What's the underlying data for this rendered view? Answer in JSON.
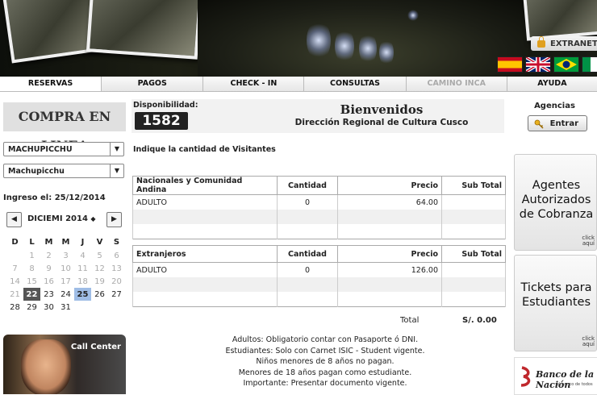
{
  "banner": {
    "extranet_label": "EXTRANET",
    "flags": [
      "spain-flag",
      "uk-flag",
      "brazil-flag",
      "italy-flag"
    ]
  },
  "nav": {
    "tabs": [
      {
        "label": "RESERVAS",
        "state": "active"
      },
      {
        "label": "PAGOS",
        "state": "normal"
      },
      {
        "label": "CHECK - IN",
        "state": "normal"
      },
      {
        "label": "CONSULTAS",
        "state": "normal"
      },
      {
        "label": "CAMINO INCA",
        "state": "disabled"
      },
      {
        "label": "AYUDA",
        "state": "normal"
      }
    ]
  },
  "left": {
    "compra_title": "COMPRA EN LINEA",
    "select_destination": "MACHUPICCHU",
    "select_route": "Machupicchu",
    "ingreso_label": "Ingreso el:",
    "ingreso_date": "25/12/2014",
    "calendar": {
      "month": "DICIEMI",
      "year": "2014",
      "weekdays": [
        "D",
        "L",
        "M",
        "M",
        "J",
        "V",
        "S"
      ],
      "weeks": [
        [
          "",
          "1",
          "2",
          "3",
          "4",
          "5",
          "6"
        ],
        [
          "7",
          "8",
          "9",
          "10",
          "11",
          "12",
          "13"
        ],
        [
          "14",
          "15",
          "16",
          "17",
          "18",
          "19",
          "20"
        ],
        [
          "21",
          "22",
          "23",
          "24",
          "25",
          "26",
          "27"
        ],
        [
          "28",
          "29",
          "30",
          "31",
          "",
          "",
          ""
        ]
      ],
      "selected_day": "22",
      "highlighted_day": "25"
    },
    "callcenter_label": "Call Center"
  },
  "main": {
    "disponibilidad_label": "Disponibilidad:",
    "disponibilidad_value": "1582",
    "welcome_title": "Bienvenidos",
    "welcome_subtitle": "Dirección Regional de Cultura Cusco",
    "indique": "Indique la cantidad de Visitantes",
    "nacionales": {
      "headers": [
        "Nacionales y Comunidad Andina",
        "Cantidad",
        "Precio",
        "Sub Total"
      ],
      "rows": [
        [
          "ADULTO",
          "0",
          "64.00",
          ""
        ]
      ]
    },
    "extranjeros": {
      "headers": [
        "Extranjeros",
        "Cantidad",
        "Precio",
        "Sub Total"
      ],
      "rows": [
        [
          "ADULTO",
          "0",
          "126.00",
          ""
        ]
      ]
    },
    "total_label": "Total",
    "total_value": "S/. 0.00",
    "notes": [
      "Adultos: Obligatorio contar con Pasaporte ó DNI.",
      "Estudiantes: Solo con Carnet ISIC - Student vigente.",
      "Niños menores de 8 años no pagan.",
      "Menores de 18 años pagan como estudiante.",
      "Importante: Presentar documento vigente."
    ]
  },
  "right": {
    "agencias_label": "Agencias",
    "entrar_label": "Entrar",
    "card1_lines": [
      "Agentes",
      "Autorizados",
      "de Cobranza"
    ],
    "card2_lines": [
      "Tickets para",
      "Estudiantes"
    ],
    "click_line1": "click",
    "click_line2": "aquí",
    "banco_name": "Banco de la Nación",
    "banco_slogan": "el banco de todos"
  }
}
